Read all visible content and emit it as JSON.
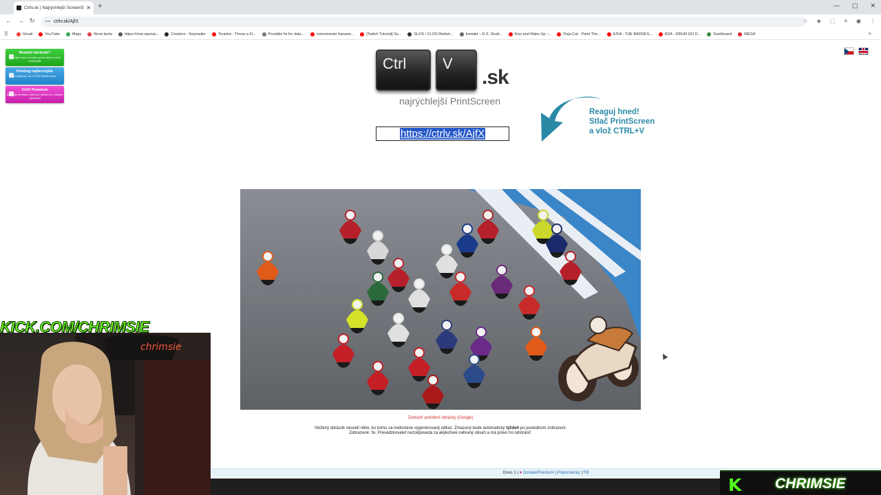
{
  "browser": {
    "tab_title": "Ctrlv.sk | Najrýchlejší ScreenSh...",
    "address": "ctrlv.sk/AjfX",
    "bookmarks": [
      {
        "label": "Gmail",
        "color": "#ea4335"
      },
      {
        "label": "YouTube",
        "color": "#ff0000"
      },
      {
        "label": "Mapy",
        "color": "#34a853"
      },
      {
        "label": "Nová karta",
        "color": "#d44"
      },
      {
        "label": "https://chat.openai...",
        "color": "#555"
      },
      {
        "label": "Creators - Keymailer",
        "color": "#222"
      },
      {
        "label": "Tinashe - Throw a Fi...",
        "color": "#ff0000"
      },
      {
        "label": "Possible fix for dela...",
        "color": "#777"
      },
      {
        "label": "voicemeeter banana...",
        "color": "#ff0000"
      },
      {
        "label": "[Twitch Tutorial] Se...",
        "color": "#ff0000"
      },
      {
        "label": "SLOS / CLOS Market...",
        "color": "#333"
      },
      {
        "label": "kontakt – D.S. Studi...",
        "color": "#666"
      },
      {
        "label": "Kiss and Make Up -...",
        "color": "#ff0000"
      },
      {
        "label": "Doja Cat - Paint The...",
        "color": "#ff0000"
      },
      {
        "label": "K/DA - THE BADDES...",
        "color": "#ff0000"
      },
      {
        "label": "KDA - DRUM GO D...",
        "color": "#ff0000"
      },
      {
        "label": "Dashboard",
        "color": "#3a8a3a"
      },
      {
        "label": "MEGA",
        "color": "#d9272e"
      }
    ]
  },
  "promos": [
    {
      "title": "Nestačí obrázok?",
      "text": "Nahrajte video rovnako rýchlo alebo rovno nahrávajte"
    },
    {
      "title": "Hosting najlacnejšie",
      "text": "Hosting len za 1.23 €! Skúste teraz"
    },
    {
      "title": "CtrlV Premium",
      "text": "Aktivujte prémium účet bez reklám a s ďalšími výhodami"
    }
  ],
  "logo": {
    "key1": "Ctrl",
    "key2": "V",
    "suffix": ".sk",
    "tagline": "najrýchlejší PrintScreen"
  },
  "share_url": "https://ctrlv.sk/AjfX",
  "callout": {
    "line1": "Reaguj hned!",
    "line2": "Stlač PrintScreen",
    "line3": "a vlož CTRL+V"
  },
  "similar_link": "Zobraziť podobné obrázky (Google)",
  "notice1_pre": "Vložený obrázok neuvidí nikto, ku komu sa nedostane vygenerovaný odkaz. Zmazaný bude automaticky ",
  "notice1_bold": "týždeň",
  "notice1_post": " po poslednom zobrazení.",
  "notice2": "Zobrazené: 3x. Prevádzkovateľ nezodpovedá za akýkoľvek nahraný obsah a má právo ho odstrániť.",
  "footer": {
    "today": "Dnes 1 |",
    "heart": "♥",
    "donate": "Donate/Premium",
    "sep": "|",
    "feedback": "Pripomienky",
    "fb": "FB"
  },
  "stream": {
    "kick_url": "KICK.COM/CHRIMSIE",
    "kick_logo": "K",
    "channel": "CHRIMSIE",
    "cam_text": "chrimsie"
  },
  "colors": {
    "callout": "#2a8aa6",
    "selection": "#2458c8",
    "kick_green": "#53fc18"
  }
}
